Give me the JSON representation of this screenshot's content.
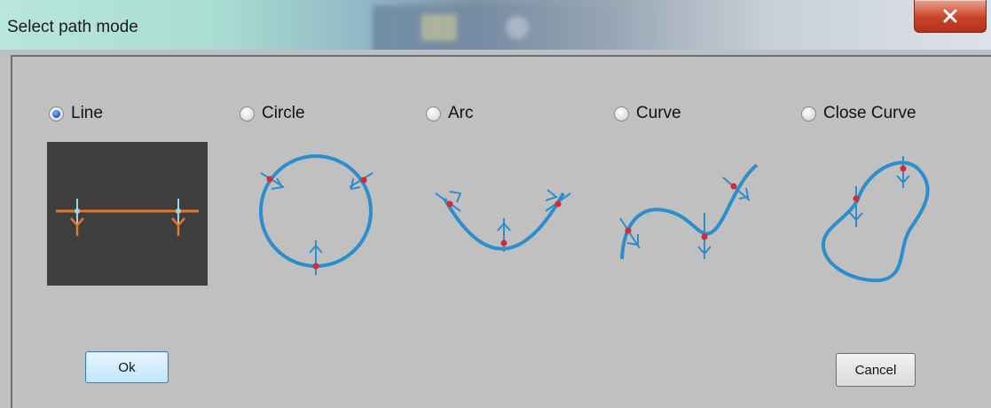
{
  "window": {
    "title": "Select path mode",
    "close_glyph": "x"
  },
  "options": [
    {
      "label": "Line",
      "checked": true,
      "icon": "line-path-icon"
    },
    {
      "label": "Circle",
      "checked": false,
      "icon": "circle-path-icon"
    },
    {
      "label": "Arc",
      "checked": false,
      "icon": "arc-path-icon"
    },
    {
      "label": "Curve",
      "checked": false,
      "icon": "curve-path-icon"
    },
    {
      "label": "Close Curve",
      "checked": false,
      "icon": "close-curve-path-icon"
    }
  ],
  "buttons": {
    "ok_label": "Ok",
    "cancel_label": "Cancel"
  },
  "colors": {
    "path_blue": "#2a8fcc",
    "marker_red": "#d8283c",
    "line_orange": "#e8732b",
    "line_marker_cyan": "#9fd7e0",
    "dark_preview_bg": "#3e3e3e",
    "dialog_bg": "#c0c0c0"
  }
}
